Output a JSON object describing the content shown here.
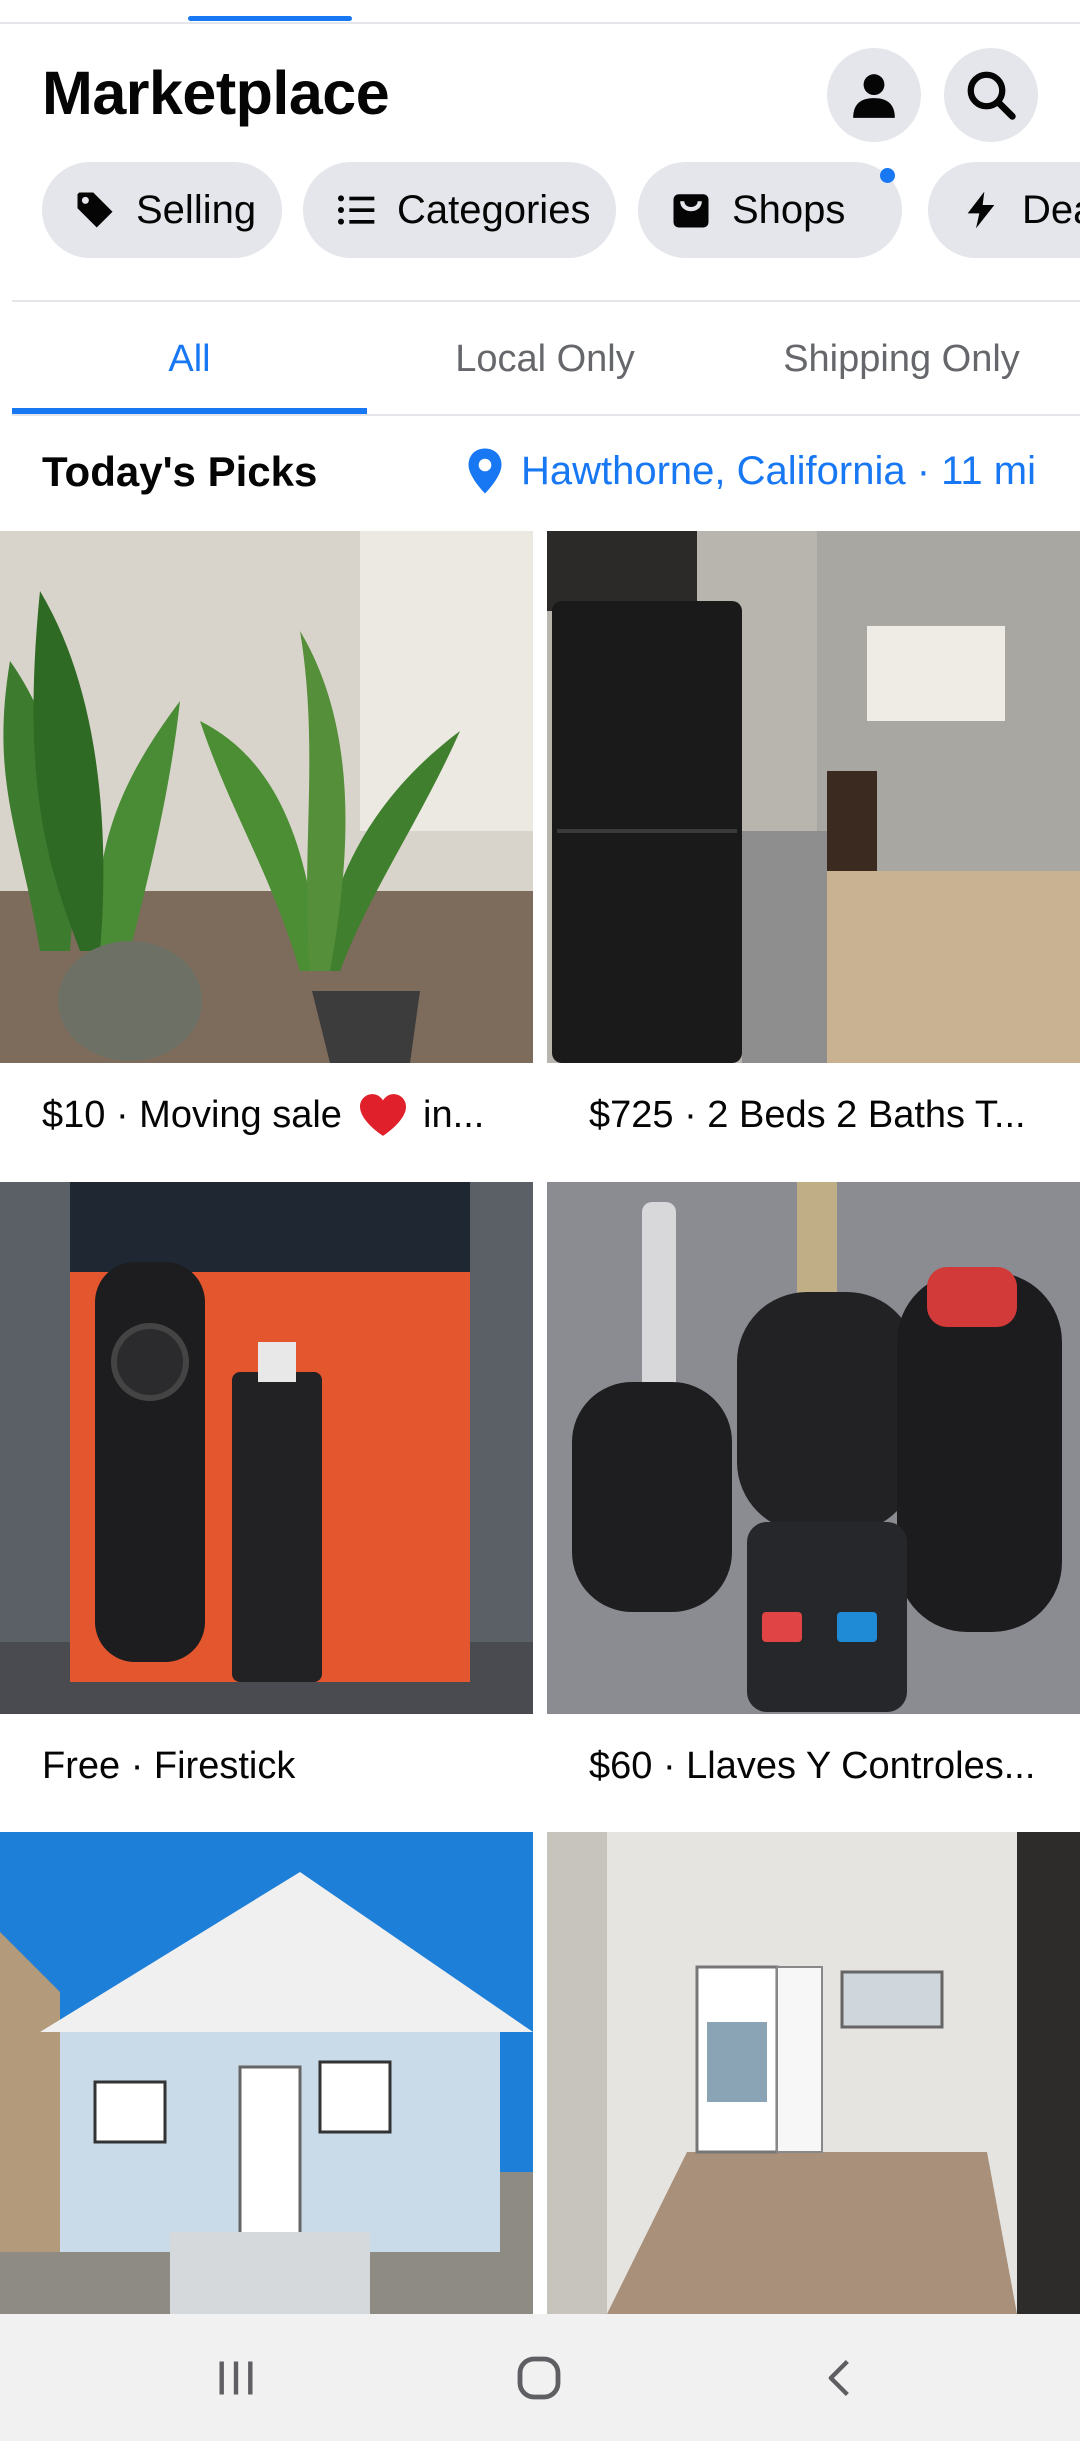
{
  "header": {
    "title": "Marketplace",
    "profile_icon": "person-icon",
    "search_icon": "search-icon"
  },
  "chips": [
    {
      "label": "Selling",
      "icon": "tag-icon"
    },
    {
      "label": "Categories",
      "icon": "list-icon"
    },
    {
      "label": "Shops",
      "icon": "shop-bag-icon"
    },
    {
      "label": "Dea",
      "icon": "lightning-icon"
    }
  ],
  "tabs": [
    {
      "label": "All",
      "selected": true
    },
    {
      "label": "Local Only",
      "selected": false
    },
    {
      "label": "Shipping Only",
      "selected": false
    }
  ],
  "picks": {
    "title": "Today's Picks",
    "location": "Hawthorne, California · 11 mi"
  },
  "listings": [
    {
      "caption_before": "$10 · Moving sale ",
      "caption_after": " in...",
      "has_heart": true,
      "image": "potted plants"
    },
    {
      "caption_before": "$725 · 2 Beds 2 Baths T...",
      "caption_after": "",
      "has_heart": false,
      "image": "kitchen with black refrigerator"
    },
    {
      "caption_before": "Free · Firestick",
      "caption_after": "",
      "has_heart": false,
      "image": "fire tv stick box and remote"
    },
    {
      "caption_before": "$60 · Llaves Y Controles...",
      "caption_after": "",
      "has_heart": false,
      "image": "car keys and remotes"
    },
    {
      "image": "white house"
    },
    {
      "image": "empty room with open door"
    }
  ],
  "colors": {
    "accent": "#1877f2",
    "chip_bg": "#e4e6eb",
    "muted_text": "#65676b"
  },
  "navbar": {
    "recents_icon": "recents-icon",
    "home_icon": "home-icon",
    "back_icon": "back-icon"
  }
}
